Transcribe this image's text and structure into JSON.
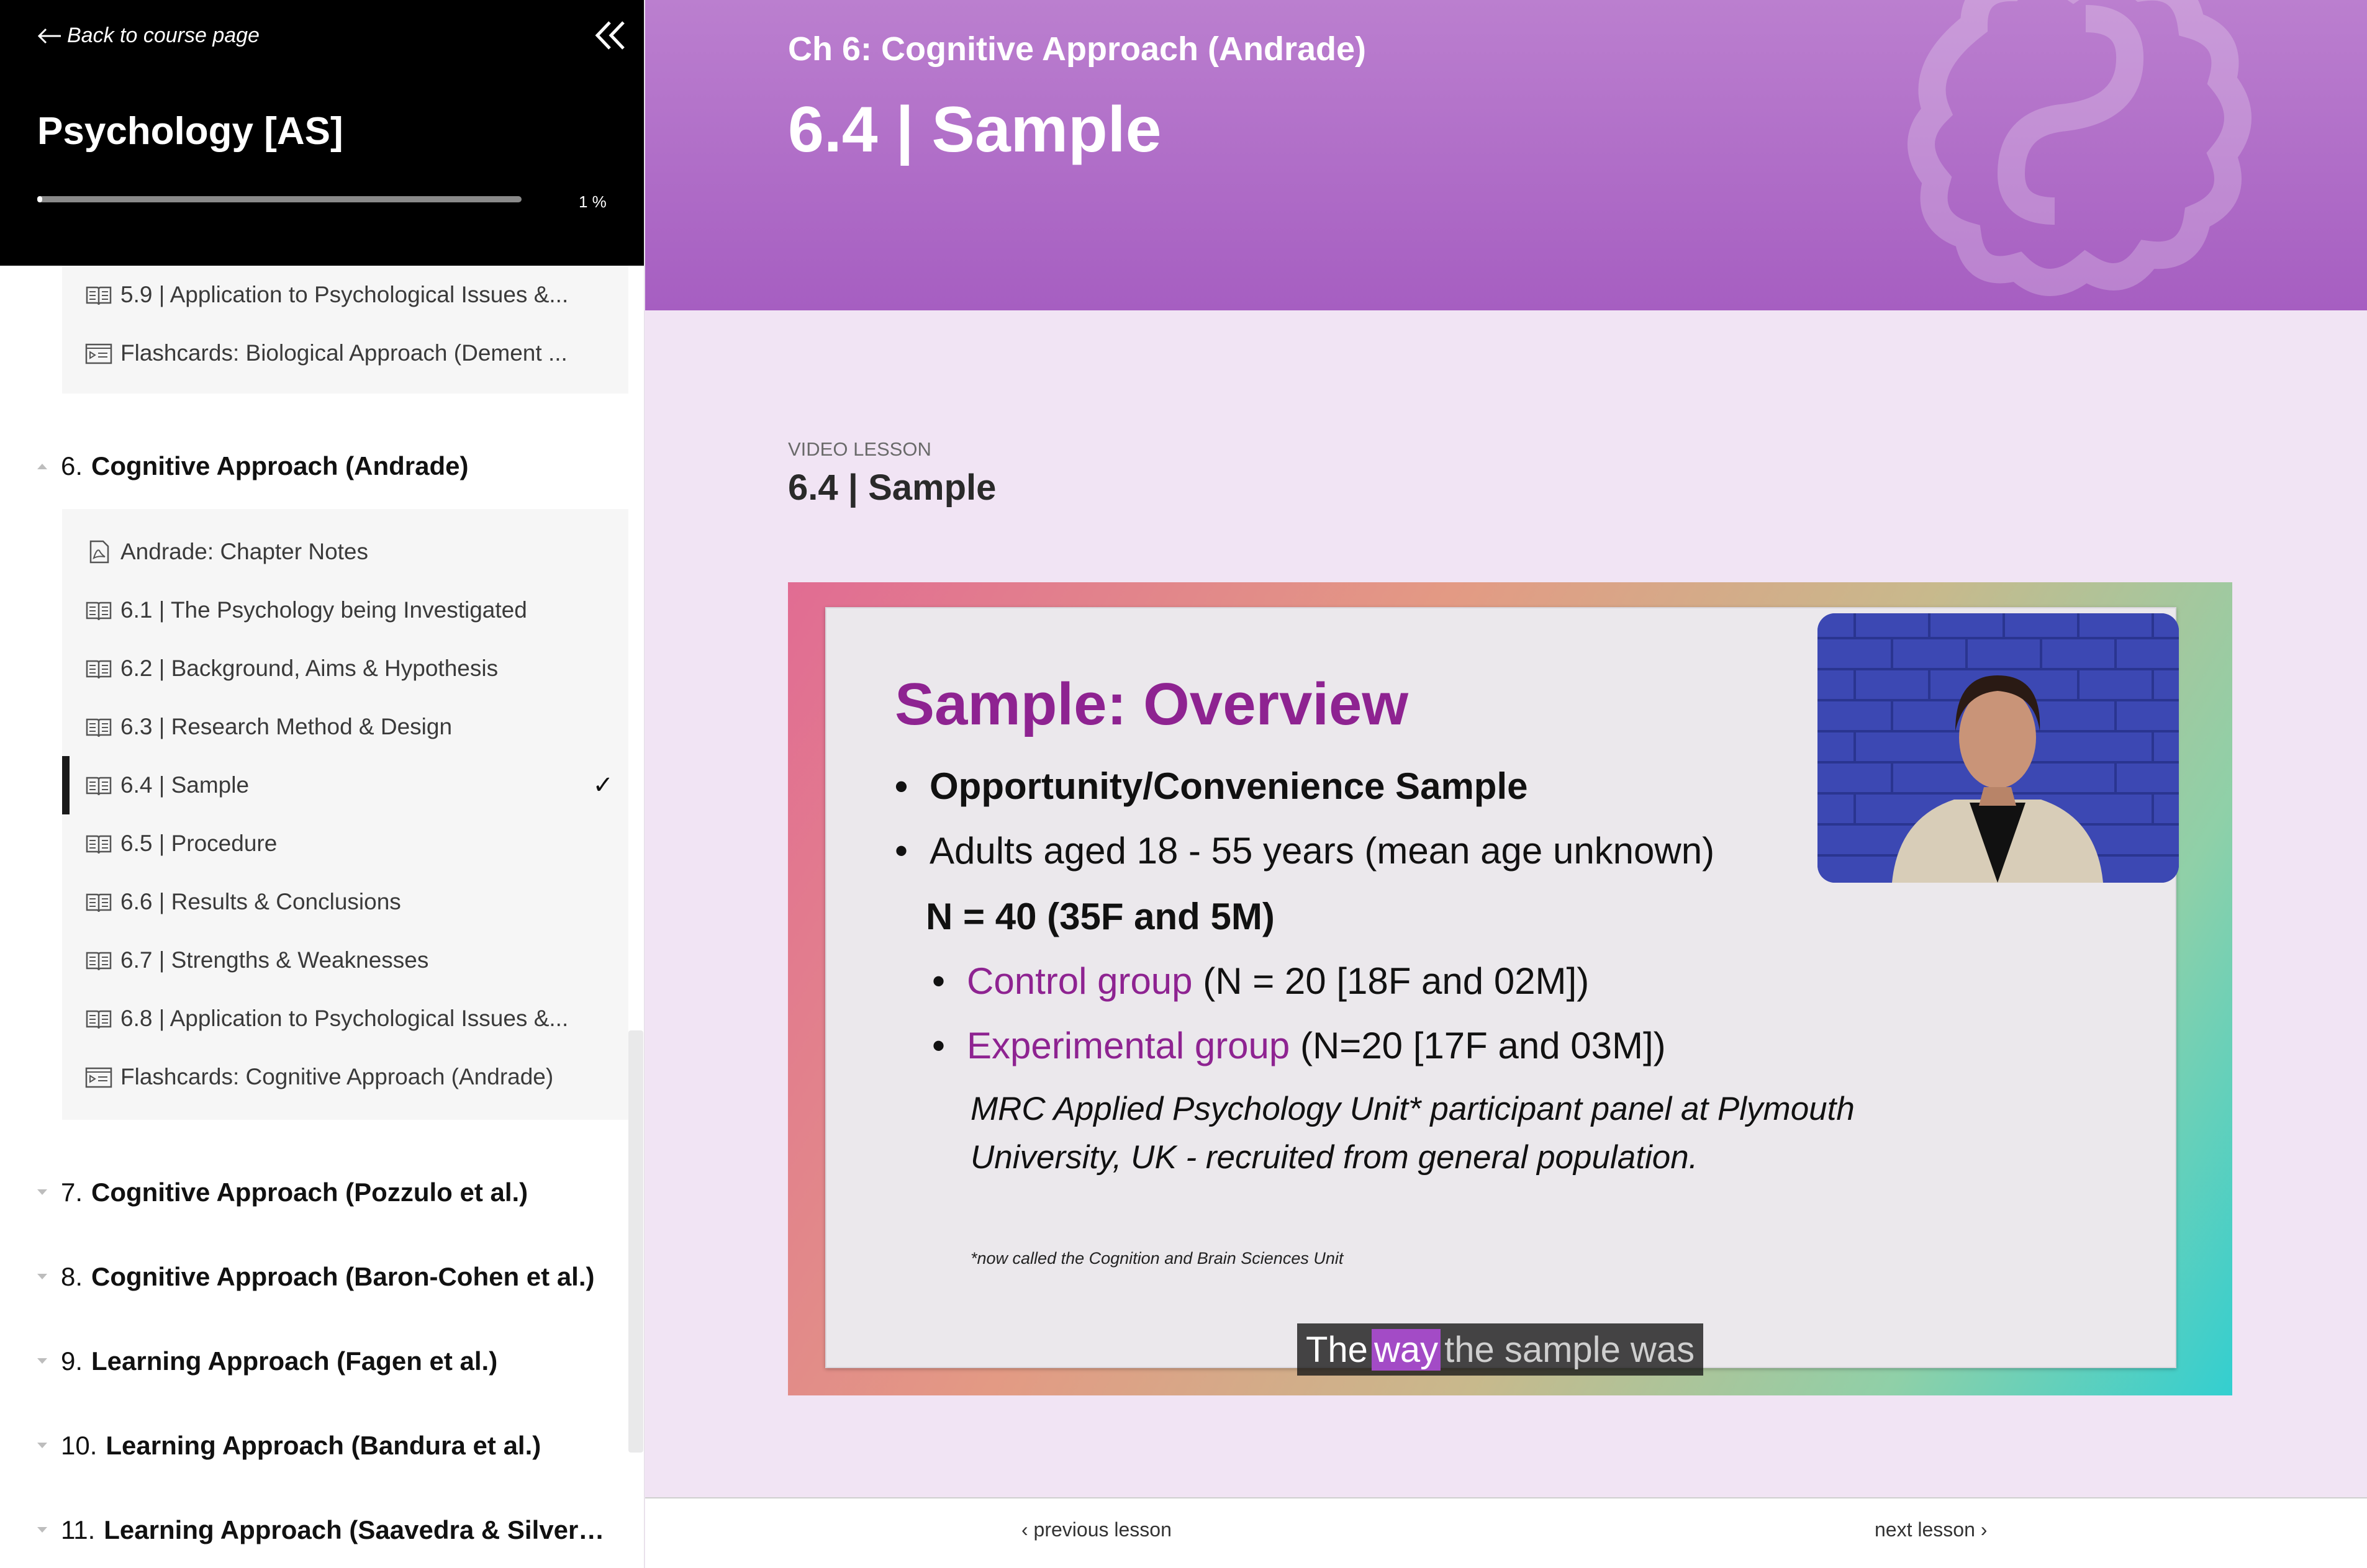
{
  "sidebar": {
    "back_label": "Back to course page",
    "course_title": "Psychology [AS]",
    "progress_percent": 1,
    "progress_label": "1 %",
    "prev_items": [
      {
        "label": "5.9 | Application to Psychological Issues &...",
        "icon": "book-icon"
      },
      {
        "label": "Flashcards: Biological Approach (Dement ...",
        "icon": "flashcards-icon"
      }
    ],
    "current_chapter": {
      "num": "6.",
      "name": "Cognitive Approach (Andrade)"
    },
    "lessons": [
      {
        "label": "Andrade: Chapter Notes",
        "icon": "pdf-icon"
      },
      {
        "label": "6.1 | The Psychology being Investigated",
        "icon": "book-icon"
      },
      {
        "label": "6.2 | Background, Aims & Hypothesis",
        "icon": "book-icon"
      },
      {
        "label": "6.3 | Research Method & Design",
        "icon": "book-icon"
      },
      {
        "label": "6.4 | Sample",
        "icon": "book-icon",
        "active": true,
        "check": "✓"
      },
      {
        "label": "6.5 | Procedure",
        "icon": "book-icon"
      },
      {
        "label": "6.6 | Results & Conclusions",
        "icon": "book-icon"
      },
      {
        "label": "6.7 | Strengths & Weaknesses",
        "icon": "book-icon"
      },
      {
        "label": "6.8 | Application to Psychological Issues &...",
        "icon": "book-icon"
      },
      {
        "label": "Flashcards: Cognitive Approach (Andrade)",
        "icon": "flashcards-icon"
      }
    ],
    "chapters": [
      {
        "num": "7.",
        "name": "Cognitive Approach (Pozzulo et al.)"
      },
      {
        "num": "8.",
        "name": "Cognitive Approach (Baron-Cohen et al.)"
      },
      {
        "num": "9.",
        "name": "Learning Approach (Fagen et al.)"
      },
      {
        "num": "10.",
        "name": "Learning Approach (Bandura et al.)"
      },
      {
        "num": "11.",
        "name": "Learning Approach (Saavedra & Silver…"
      }
    ]
  },
  "banner": {
    "chapter": "Ch 6: Cognitive Approach (Andrade)",
    "title": "6.4 | Sample"
  },
  "content": {
    "kind": "VIDEO LESSON",
    "title": "6.4 | Sample"
  },
  "slide": {
    "title": "Sample: Overview",
    "bullet_glyph": "•",
    "b1": "Opportunity/Convenience Sample",
    "b2": "Adults aged 18 - 55 years (mean age unknown)",
    "b3": "N = 40 (35F and 5M)",
    "b4_colored": "Control group",
    "b4_rest": " (N = 20 [18F and 02M])",
    "b5_colored": "Experimental group",
    "b5_rest": " (N=20 [17F and 03M])",
    "note": "MRC Applied Psychology Unit* participant panel at Plymouth University, UK - recruited from general population.",
    "footnote": "*now called the Cognition and Brain Sciences Unit"
  },
  "caption": {
    "pre": "The",
    "highlight": "way",
    "post": "the sample was"
  },
  "nav": {
    "prev": "previous lesson",
    "next": "next lesson"
  },
  "colors": {
    "accent": "#a65ec1",
    "slide_purple": "#8e2391"
  }
}
